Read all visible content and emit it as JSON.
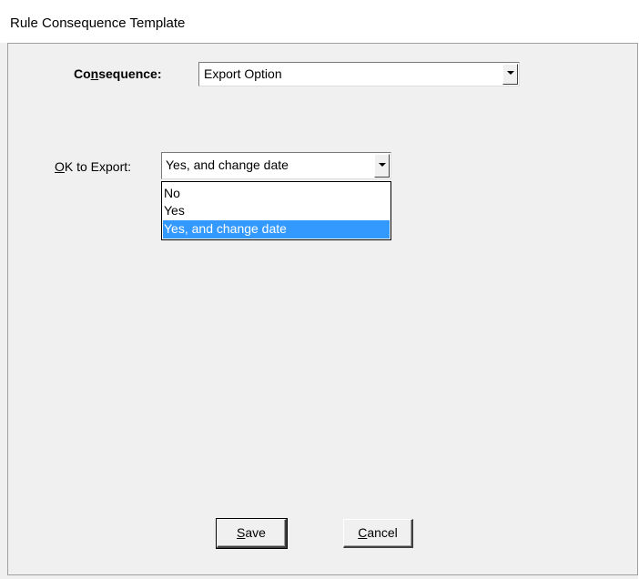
{
  "window": {
    "title": "Rule Consequence Template"
  },
  "consequence": {
    "label_pre": "Co",
    "label_mnemonic": "n",
    "label_post": "sequence:",
    "value": "Export Option"
  },
  "ok_to_export": {
    "label_mnemonic": "O",
    "label_post": "K to Export:",
    "value": "Yes, and change date",
    "options": [
      "No",
      "Yes",
      "Yes, and change date"
    ],
    "selected_index": 2
  },
  "buttons": {
    "save_mnemonic": "S",
    "save_post": "ave",
    "cancel_mnemonic": "C",
    "cancel_post": "ancel"
  },
  "colors": {
    "selection": "#3399ff",
    "face": "#f0f0f0"
  }
}
